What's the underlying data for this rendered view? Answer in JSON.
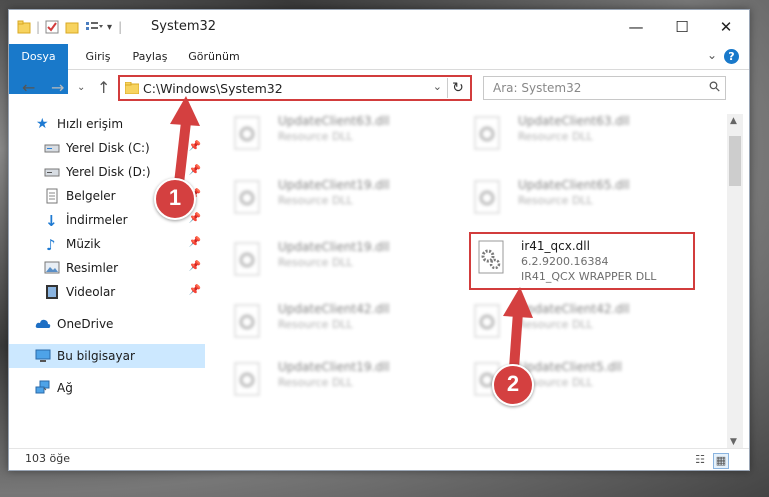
{
  "window": {
    "title": "System32",
    "controls": {
      "minimize": "—",
      "maximize": "☐",
      "close": "✕"
    }
  },
  "ribbon": {
    "tabs": [
      {
        "label": "Dosya",
        "active": true
      },
      {
        "label": "Giriş"
      },
      {
        "label": "Paylaş"
      },
      {
        "label": "Görünüm"
      }
    ],
    "help": "?"
  },
  "address": {
    "path": "C:\\Windows\\System32",
    "search_placeholder": "Ara: System32"
  },
  "sidebar": {
    "items": [
      {
        "label": "Hızlı erişim",
        "icon": "star-icon"
      },
      {
        "label": "Yerel Disk (C:)",
        "icon": "drive-icon",
        "pinned": true
      },
      {
        "label": "Yerel Disk (D:)",
        "icon": "drive-icon",
        "pinned": true
      },
      {
        "label": "Belgeler",
        "icon": "document-icon",
        "pinned": true
      },
      {
        "label": "İndirmeler",
        "icon": "download-icon",
        "pinned": true
      },
      {
        "label": "Müzik",
        "icon": "music-icon",
        "pinned": true
      },
      {
        "label": "Resimler",
        "icon": "pictures-icon",
        "pinned": true
      },
      {
        "label": "Videolar",
        "icon": "video-icon",
        "pinned": true
      },
      {
        "label": "OneDrive",
        "icon": "cloud-icon"
      },
      {
        "label": "Bu bilgisayar",
        "icon": "computer-icon",
        "selected": true
      },
      {
        "label": "Ağ",
        "icon": "network-icon"
      }
    ]
  },
  "files": [
    {
      "name": "UpdateClient63.dll",
      "desc": "Resource DLL"
    },
    {
      "name": "UpdateClient63.dll",
      "desc": "Resource DLL"
    },
    {
      "name": "UpdateClient19.dll",
      "desc": "Resource DLL"
    },
    {
      "name": "UpdateClient65.dll",
      "desc": "Resource DLL"
    },
    {
      "name": "UpdateClient19.dll",
      "desc": "Resource DLL"
    },
    {
      "name": "ir41_qcx.dll",
      "version": "6.2.9200.16384",
      "desc": "IR41_QCX WRAPPER DLL",
      "highlighted": true
    },
    {
      "name": "UpdateClient42.dll",
      "desc": "Resource DLL"
    },
    {
      "name": "UpdateClient42.dll",
      "desc": "Resource DLL"
    },
    {
      "name": "UpdateClient19.dll",
      "desc": "Resource DLL"
    },
    {
      "name": "UpdateClient5.dll",
      "desc": "Resource DLL"
    }
  ],
  "status": {
    "item_count": "103 öğe"
  },
  "annotations": {
    "step1": "1",
    "step2": "2",
    "color": "#d44040"
  }
}
